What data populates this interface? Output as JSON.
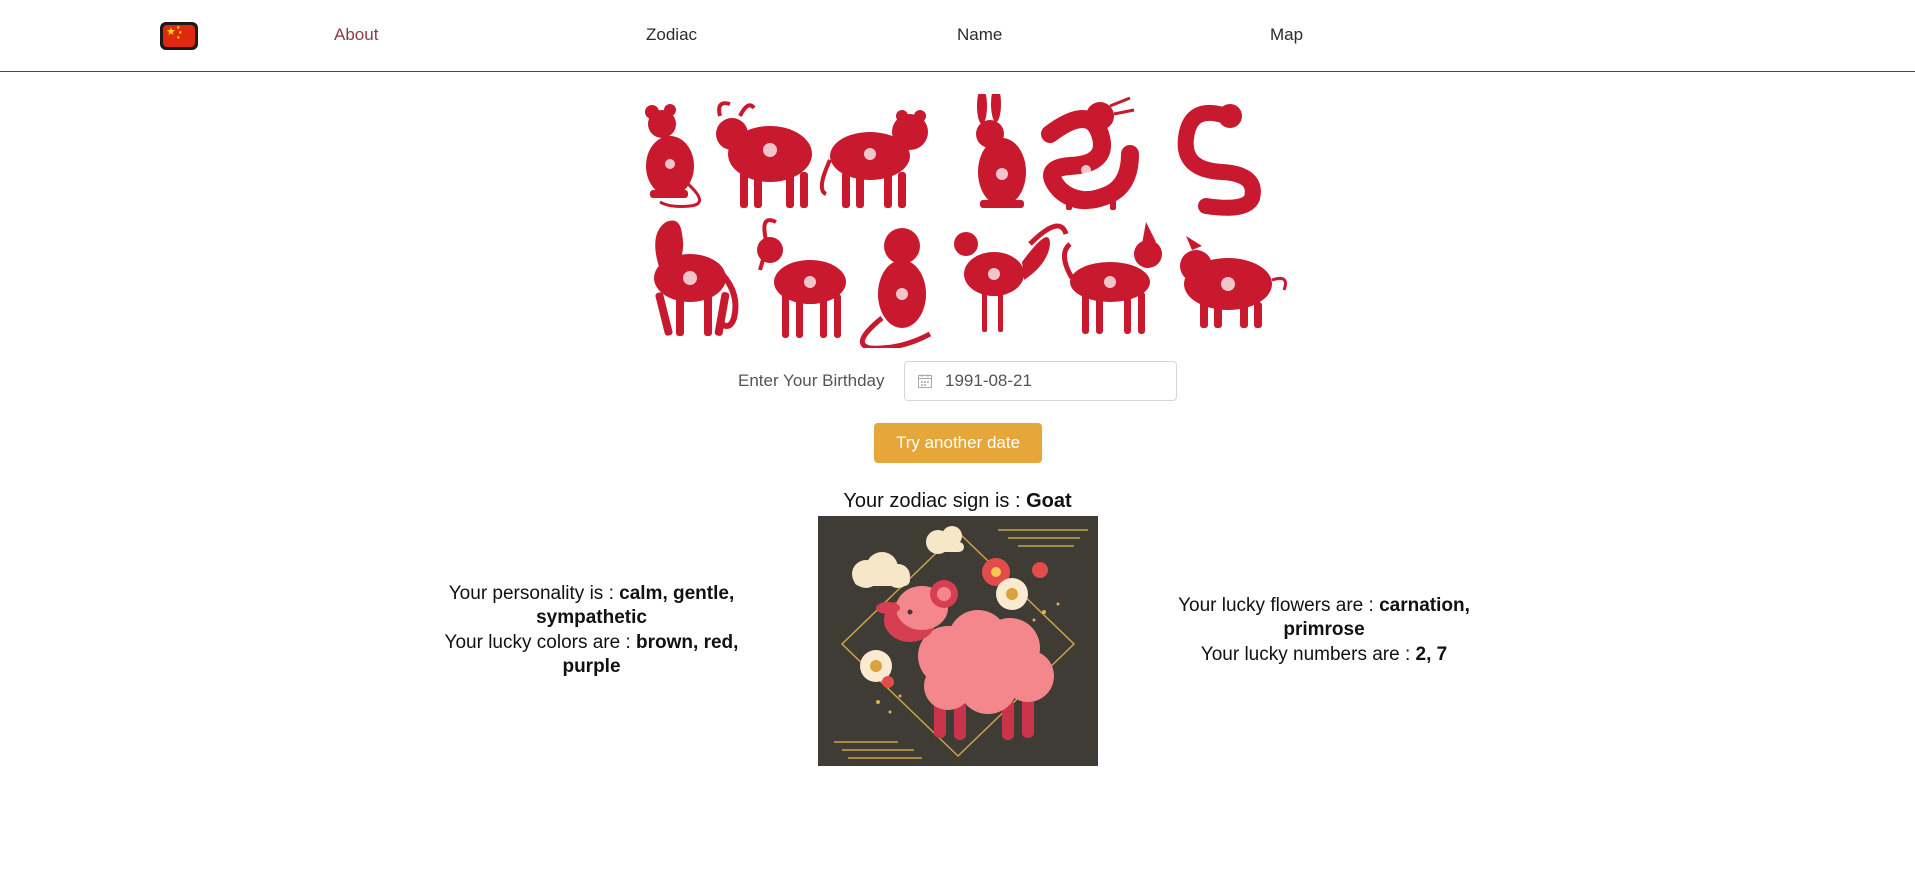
{
  "nav": {
    "flag_icon": "china-flag-icon",
    "links": [
      "About",
      "Zodiac",
      "Name",
      "Map"
    ],
    "active": "About",
    "active_color": "#8b3a44"
  },
  "form": {
    "birthday_label": "Enter Your Birthday",
    "date_value": "1991-08-21",
    "submit_label": "Try another date",
    "button_color": "#e5a63a"
  },
  "result": {
    "sign_prefix": "Your zodiac sign is : ",
    "sign": "Goat",
    "personality_prefix": "Your personality is : ",
    "personality": "calm, gentle, sympathetic",
    "colors_prefix": "Your lucky colors are : ",
    "colors": "brown, red, purple",
    "flowers_prefix": "Your lucky flowers are : ",
    "flowers": "carnation, primrose",
    "numbers_prefix": "Your lucky numbers are : ",
    "numbers": "2, 7"
  },
  "theme": {
    "zodiac_red": "#c8192e",
    "card_bg": "#3f3c35",
    "goat_pink": "#f4878b"
  }
}
